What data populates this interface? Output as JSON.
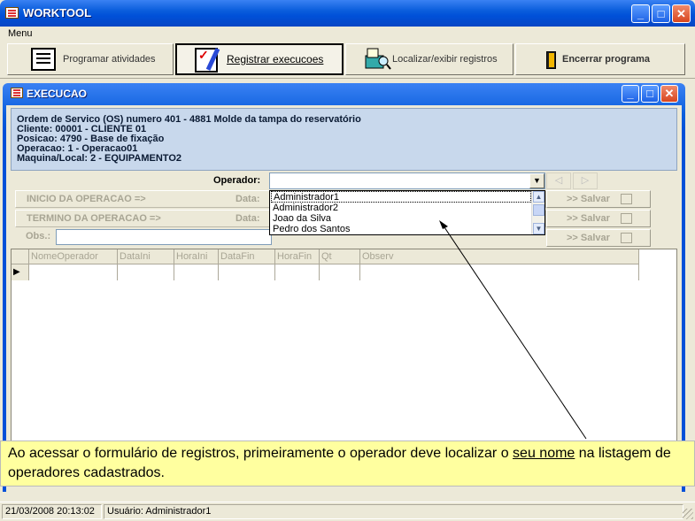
{
  "app": {
    "title": "WORKTOOL"
  },
  "menu": {
    "label": "Menu"
  },
  "toolbar": {
    "programar": "Programar atividades",
    "registrar": "Registrar execucoes",
    "localizar": "Localizar/exibir registros",
    "encerrar": "Encerrar programa"
  },
  "child_window": {
    "title": "EXECUCAO"
  },
  "info": {
    "line1": "Ordem de Servico (OS) numero 401 - 4881 Molde da tampa do reservatório",
    "line2": "Cliente: 00001 - CLIENTE 01",
    "line3": "Posicao: 4790 - Base de fixação",
    "line4": "Operacao: 1 - Operacao01",
    "line5": "Maquina/Local: 2 - EQUIPAMENTO2"
  },
  "form": {
    "operador_label": "Operador:",
    "operador_value": "",
    "inicio_label": "INICIO DA OPERACAO =>",
    "termino_label": "TERMINO DA OPERACAO =>",
    "data_label": "Data:",
    "obs_label": "Obs.:",
    "salvar_label": ">> Salvar",
    "nav_prev": "◁",
    "nav_next": "▷"
  },
  "dropdown": {
    "options": [
      "Administrador1",
      "Administrador2",
      "Joao da Silva",
      "Pedro dos Santos"
    ],
    "selected": "Administrador1"
  },
  "grid": {
    "columns": [
      "NomeOperador",
      "DataIni",
      "HoraIni",
      "DataFin",
      "HoraFin",
      "Qt Horas",
      "Observ"
    ],
    "row_indicator": "▶"
  },
  "callout": {
    "before": "Ao acessar o formulário de registros, primeiramente o operador deve localizar o ",
    "underlined": "seu nome",
    "after": " na listagem de operadores cadastrados."
  },
  "status": {
    "datetime": "21/03/2008 20:13:02",
    "user": "Usuário: Administrador1"
  }
}
